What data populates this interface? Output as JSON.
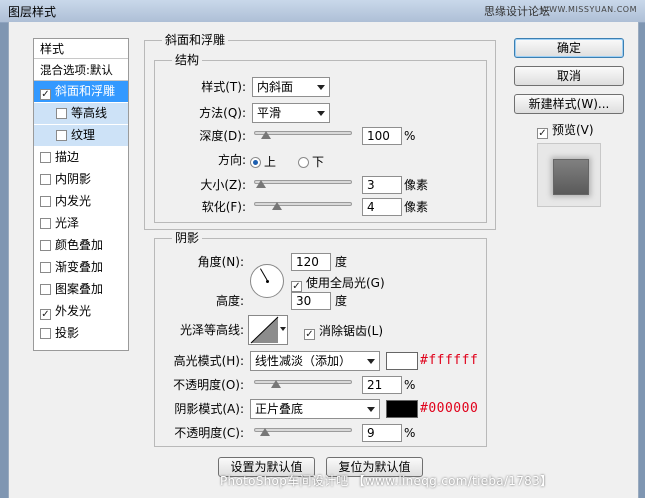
{
  "window": {
    "title": "图层样式",
    "watermark_cn": "思缘设计论坛",
    "watermark_url": "WWW.MISSYUAN.COM"
  },
  "sidebar": {
    "header": "样式",
    "blend_options": "混合选项:默认",
    "items": [
      {
        "label": "斜面和浮雕",
        "checked": "✓"
      },
      {
        "label": "等高线",
        "checked": ""
      },
      {
        "label": "纹理",
        "checked": ""
      },
      {
        "label": "描边",
        "checked": ""
      },
      {
        "label": "内阴影",
        "checked": ""
      },
      {
        "label": "内发光",
        "checked": ""
      },
      {
        "label": "光泽",
        "checked": ""
      },
      {
        "label": "颜色叠加",
        "checked": ""
      },
      {
        "label": "渐变叠加",
        "checked": ""
      },
      {
        "label": "图案叠加",
        "checked": ""
      },
      {
        "label": "外发光",
        "checked": "✓"
      },
      {
        "label": "投影",
        "checked": ""
      }
    ]
  },
  "bevel": {
    "section_title": "斜面和浮雕",
    "structure_title": "结构",
    "style_label": "样式(T):",
    "style_value": "内斜面",
    "technique_label": "方法(Q):",
    "technique_value": "平滑",
    "depth_label": "深度(D):",
    "depth_value": "100",
    "depth_unit": "%",
    "direction_label": "方向:",
    "direction_up": "上",
    "direction_down": "下",
    "size_label": "大小(Z):",
    "size_value": "3",
    "size_unit": "像素",
    "soften_label": "软化(F):",
    "soften_value": "4",
    "soften_unit": "像素"
  },
  "shading": {
    "title": "阴影",
    "angle_label": "角度(N):",
    "angle_value": "120",
    "angle_unit": "度",
    "global_light_label": "使用全局光(G)",
    "altitude_label": "高度:",
    "altitude_value": "30",
    "altitude_unit": "度",
    "gloss_contour_label": "光泽等高线:",
    "antialias_label": "消除锯齿(L)",
    "highlight_mode_label": "高光模式(H):",
    "highlight_mode_value": "线性减淡（添加）",
    "highlight_hex": "#ffffff",
    "highlight_opacity_label": "不透明度(O):",
    "highlight_opacity_value": "21",
    "shadow_mode_label": "阴影模式(A):",
    "shadow_mode_value": "正片叠底",
    "shadow_hex": "#000000",
    "shadow_opacity_label": "不透明度(C):",
    "shadow_opacity_value": "9",
    "percent": "%"
  },
  "buttons": {
    "ok": "确定",
    "cancel": "取消",
    "new_style": "新建样式(W)...",
    "preview_label": "预览(V)",
    "make_default": "设置为默认值",
    "reset_default": "复位为默认值"
  },
  "footer_watermark": "PhotoShop车间设计吧 【www.lineqg.com/tieba/1783】",
  "colors": {
    "highlight_swatch": "#ffffff",
    "shadow_swatch": "#000000",
    "hex_text": "#e0001a"
  },
  "slider_levels": {
    "depth": 0.08,
    "size": 0.02,
    "soften": 0.2,
    "highlight_opacity": 0.19,
    "shadow_opacity": 0.07
  },
  "angle_degrees": 120
}
